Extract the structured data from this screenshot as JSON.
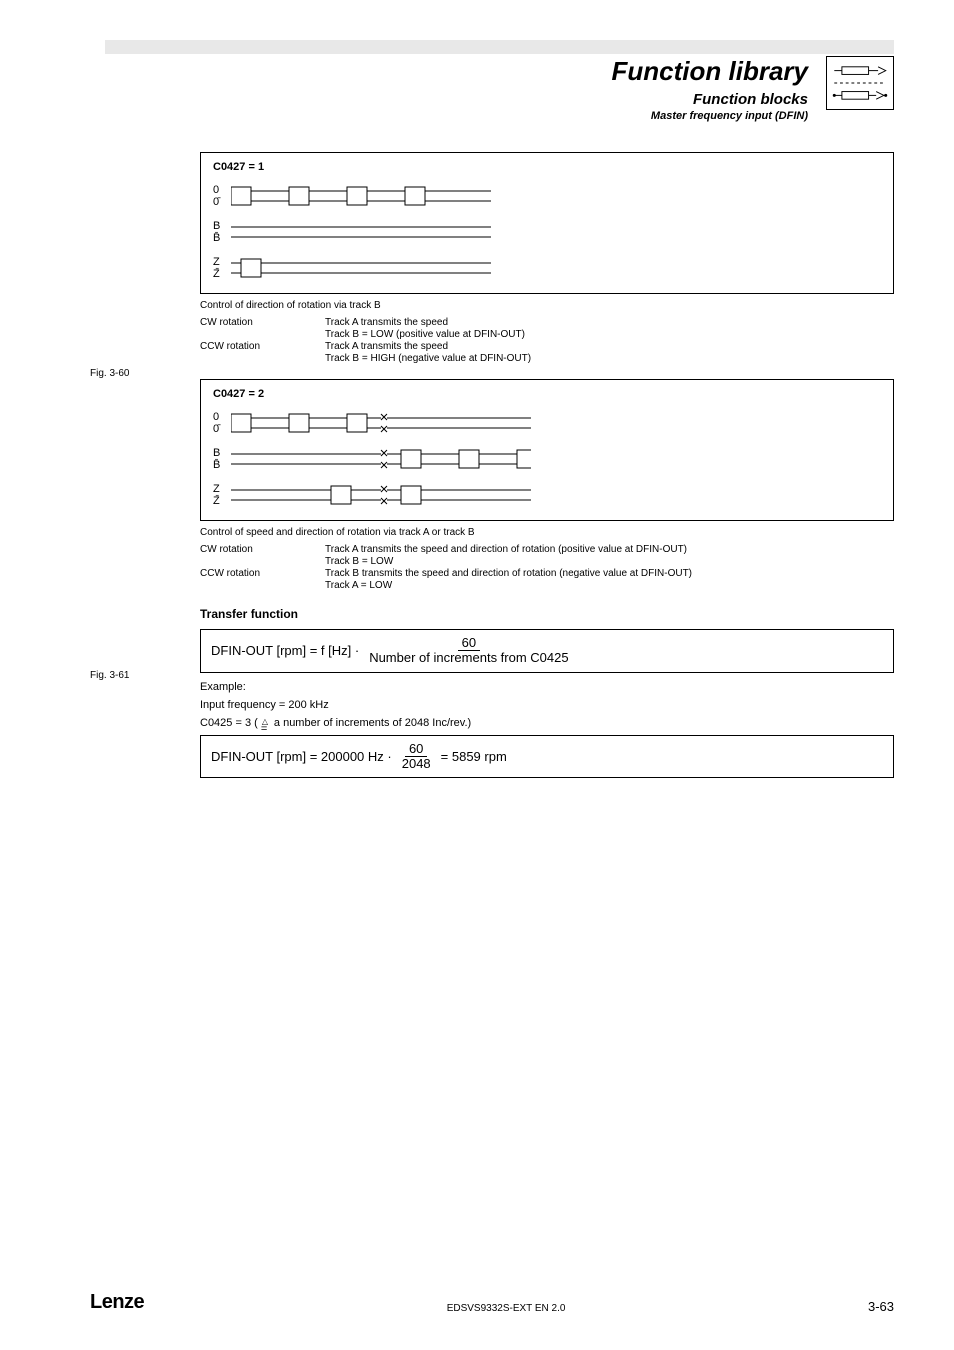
{
  "header": {
    "title": "Function library",
    "sub1": "Function blocks",
    "sub2": "Master frequency input (DFIN)"
  },
  "fig60": {
    "label": "Fig. 3-60",
    "box_title": "C0427 = 1",
    "caption": "Control of direction of rotation via track B",
    "rows": [
      {
        "key": "CW rotation",
        "val": "Track A transmits the speed"
      },
      {
        "key": "",
        "val": "Track B = LOW (positive value at DFIN-OUT)"
      },
      {
        "key": "CCW rotation",
        "val": "Track A transmits the speed"
      },
      {
        "key": "",
        "val": "Track B = HIGH (negative value at DFIN-OUT)"
      }
    ]
  },
  "fig61": {
    "label": "Fig. 3-61",
    "box_title": "C0427 = 2",
    "caption": "Control of speed and direction of rotation via track A or track B",
    "rows": [
      {
        "key": "CW rotation",
        "val": "Track A transmits the speed and direction of rotation (positive value at DFIN-OUT)"
      },
      {
        "key": "",
        "val": "Track B = LOW"
      },
      {
        "key": "CCW rotation",
        "val": "Track B transmits the speed and direction of rotation (negative value at DFIN-OUT)"
      },
      {
        "key": "",
        "val": "Track A = LOW"
      }
    ]
  },
  "transfer": {
    "heading": "Transfer function",
    "formula_left": "DFIN-OUT [rpm]  =  f [Hz]  ·",
    "formula_num": "60",
    "formula_den": "Number of increments from C0425",
    "example_label": "Example:",
    "line1": "Input frequency = 200 kHz",
    "line2_pre": "C0425 = 3 ( ",
    "line2_post": " a number of increments of 2048 Inc/rev.)",
    "formula2_left": "DFIN-OUT [rpm]  =  200000 Hz  · ",
    "formula2_num": "60",
    "formula2_den": "2048",
    "formula2_right": "  =  5859 rpm"
  },
  "footer": {
    "logo": "Lenze",
    "center": "EDSVS9332S-EXT EN 2.0",
    "page": "3-63"
  },
  "waves": {
    "labels_a": [
      "0",
      "0̄"
    ],
    "labels_b": [
      "B",
      "B̄"
    ],
    "labels_z": [
      "Z",
      "Z̄"
    ]
  }
}
